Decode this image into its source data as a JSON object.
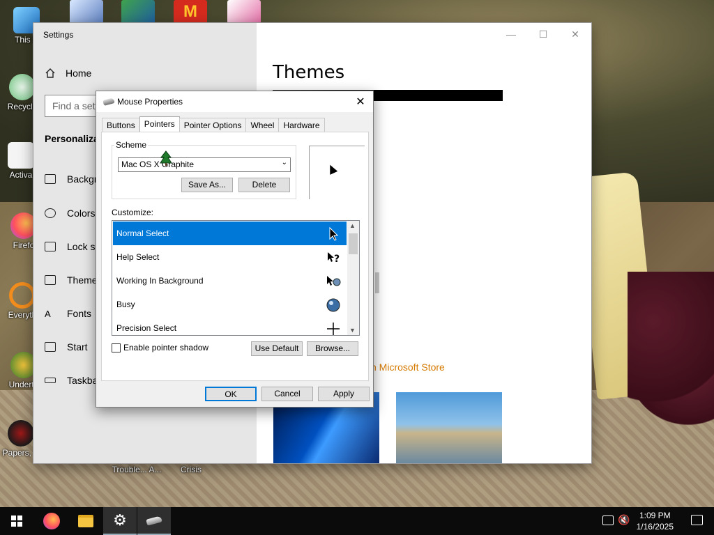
{
  "desktop": {
    "icons": [
      {
        "label": "This P",
        "name": "this-pc"
      },
      {
        "label": "Recycle",
        "name": "recycle-bin"
      },
      {
        "label": "Activa",
        "name": "activate"
      },
      {
        "label": "Firefo",
        "name": "firefox"
      },
      {
        "label": "Everyth",
        "name": "everything"
      },
      {
        "label": "Underta",
        "name": "undertale"
      },
      {
        "label": "Papers, P",
        "name": "papers-please"
      }
    ],
    "bottom_labels": [
      "Trouble... A...",
      "Crisis"
    ]
  },
  "settings": {
    "window_title": "Settings",
    "home_label": "Home",
    "find_placeholder": "Find a sett",
    "section_title": "Personalizat",
    "nav": [
      {
        "label": "Backgr",
        "icon": "image-icon"
      },
      {
        "label": "Colors",
        "icon": "palette-icon"
      },
      {
        "label": "Lock sc",
        "icon": "lock-screen-icon"
      },
      {
        "label": "Theme",
        "icon": "brush-icon"
      },
      {
        "label": "Fonts",
        "icon": "font-icon"
      },
      {
        "label": "Start",
        "icon": "start-icon"
      },
      {
        "label": "Taskba",
        "icon": "taskbar-icon"
      }
    ],
    "page_heading": "Themes",
    "store_link": "n Microsoft Store"
  },
  "mouse_dialog": {
    "title": "Mouse Properties",
    "tabs": [
      "Buttons",
      "Pointers",
      "Pointer Options",
      "Wheel",
      "Hardware"
    ],
    "active_tab": "Pointers",
    "scheme_label": "Scheme",
    "scheme_value": "Mac OS X Graphite",
    "save_as_label": "Save As...",
    "delete_label": "Delete",
    "customize_label": "Customize:",
    "cursors": [
      {
        "label": "Normal Select",
        "selected": true,
        "icon": "arrow-cursor-icon"
      },
      {
        "label": "Help Select",
        "selected": false,
        "icon": "help-cursor-icon"
      },
      {
        "label": "Working In Background",
        "selected": false,
        "icon": "working-cursor-icon"
      },
      {
        "label": "Busy",
        "selected": false,
        "icon": "busy-cursor-icon"
      },
      {
        "label": "Precision Select",
        "selected": false,
        "icon": "crosshair-cursor-icon"
      }
    ],
    "enable_shadow_label": "Enable pointer shadow",
    "enable_shadow_checked": false,
    "use_default_label": "Use Default",
    "browse_label": "Browse...",
    "ok_label": "OK",
    "cancel_label": "Cancel",
    "apply_label": "Apply"
  },
  "taskbar": {
    "time": "1:09 PM",
    "date": "1/16/2025",
    "items": [
      "start-icon",
      "firefox-icon",
      "file-explorer-icon",
      "settings-icon",
      "mouse-properties-icon"
    ]
  },
  "colors": {
    "accent": "#0078d7",
    "store_link": "#d67a00"
  }
}
